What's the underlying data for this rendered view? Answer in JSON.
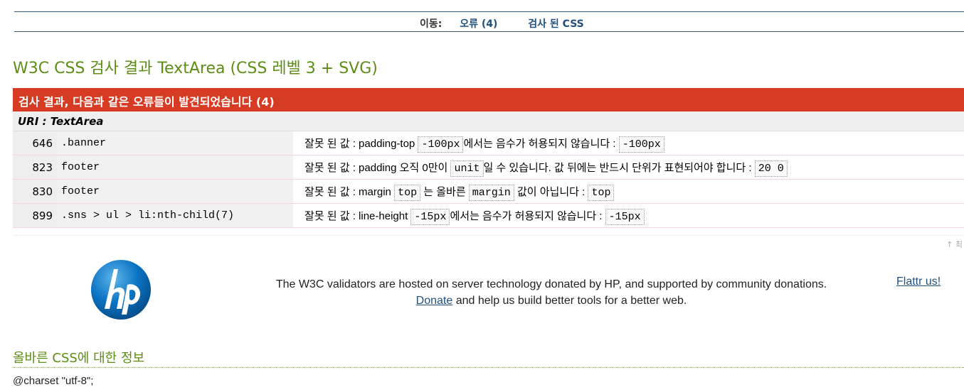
{
  "nav": {
    "label": "이동:",
    "errors_link": "오류 (4)",
    "validated_css_link": "검사 된 CSS"
  },
  "title": "W3C CSS 검사 결과 TextArea (CSS 레벨 3 + SVG)",
  "error_header": "검사 결과, 다음과 같은 오류들이 발견되었습니다 (4)",
  "uri": "URI : TextArea",
  "errors": [
    {
      "line": "646",
      "context": ".banner",
      "msg": [
        {
          "t": "잘못 된 값 : padding-top "
        },
        {
          "c": "-100px"
        },
        {
          "t": "에서는 음수가 허용되지 않습니다 : "
        },
        {
          "c": "-100px"
        }
      ]
    },
    {
      "line": "823",
      "context": "footer",
      "msg": [
        {
          "t": "잘못 된 값 : padding 오직 0만이 "
        },
        {
          "c": "unit"
        },
        {
          "t": "일 수 있습니다. 값 뒤에는 반드시 단위가 표현되어야 합니다 : "
        },
        {
          "c": "20 0"
        }
      ]
    },
    {
      "line": "830",
      "context": "footer",
      "msg": [
        {
          "t": "잘못 된 값 : margin "
        },
        {
          "c": "top"
        },
        {
          "t": " 는 올바른 "
        },
        {
          "c": "margin"
        },
        {
          "t": " 값이 아닙니다 : "
        },
        {
          "c": "top"
        }
      ]
    },
    {
      "line": "899",
      "context": ".sns > ul > li:nth-child(7)",
      "msg": [
        {
          "t": "잘못 된 값 : line-height "
        },
        {
          "c": "-15px"
        },
        {
          "t": "에서는 음수가 허용되지 않습니다 : "
        },
        {
          "c": "-15px"
        }
      ]
    }
  ],
  "back_to_top": "↑ 최",
  "sponsor": {
    "logo_text": "hp",
    "line1": "The W3C validators are hosted on server technology donated by HP, and supported by community donations.",
    "donate_link": "Donate",
    "line2_rest": " and help us build better tools for a better web.",
    "flattr": "Flattr us!"
  },
  "valid_heading": {
    "prefix": "올바른 ",
    "css": "CSS",
    "suffix": "에 대한 정보"
  },
  "css_first_line": "@charset \"utf-8\";",
  "colors": {
    "green": "#5c8d15",
    "error_red": "#d63c23",
    "link_blue": "#21507b"
  }
}
